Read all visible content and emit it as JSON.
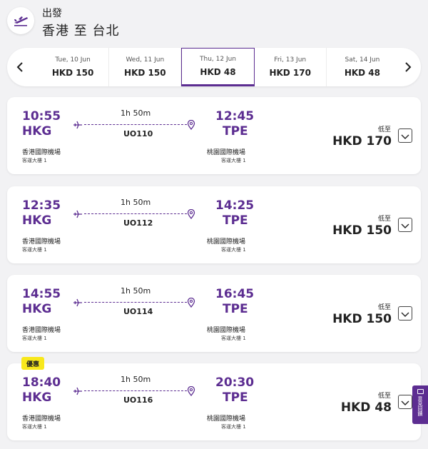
{
  "header": {
    "direction": "出發",
    "route": "香港 至 台北",
    "icon": "departure-plane-icon"
  },
  "date_strip": {
    "prev_icon": "chevron-left-icon",
    "next_icon": "chevron-right-icon",
    "dates": [
      {
        "date": "Tue, 10 Jun",
        "price": "HKD 150",
        "selected": false
      },
      {
        "date": "Wed, 11 Jun",
        "price": "HKD 150",
        "selected": false
      },
      {
        "date": "Thu, 12 Jun",
        "price": "HKD 48",
        "selected": true
      },
      {
        "date": "Fri, 13 Jun",
        "price": "HKD 170",
        "selected": false
      },
      {
        "date": "Sat, 14 Jun",
        "price": "HKD 48",
        "selected": false
      }
    ]
  },
  "flights": [
    {
      "dep_time": "10:55",
      "dep_code": "HKG",
      "dep_airport": "香港國際機場",
      "dep_terminal": "客運大樓 1",
      "arr_time": "12:45",
      "arr_code": "TPE",
      "arr_airport": "桃園國際機場",
      "arr_terminal": "客運大樓 1",
      "duration": "1h 50m",
      "flight_no": "UO110",
      "from_label": "低至",
      "price": "HKD 170",
      "badge": ""
    },
    {
      "dep_time": "12:35",
      "dep_code": "HKG",
      "dep_airport": "香港國際機場",
      "dep_terminal": "客運大樓 1",
      "arr_time": "14:25",
      "arr_code": "TPE",
      "arr_airport": "桃園國際機場",
      "arr_terminal": "客運大樓 1",
      "duration": "1h 50m",
      "flight_no": "UO112",
      "from_label": "低至",
      "price": "HKD 150",
      "badge": ""
    },
    {
      "dep_time": "14:55",
      "dep_code": "HKG",
      "dep_airport": "香港國際機場",
      "dep_terminal": "客運大樓 1",
      "arr_time": "16:45",
      "arr_code": "TPE",
      "arr_airport": "桃園國際機場",
      "arr_terminal": "客運大樓 1",
      "duration": "1h 50m",
      "flight_no": "UO114",
      "from_label": "低至",
      "price": "HKD 150",
      "badge": ""
    },
    {
      "dep_time": "18:40",
      "dep_code": "HKG",
      "dep_airport": "香港國際機場",
      "dep_terminal": "客運大樓 1",
      "arr_time": "20:30",
      "arr_code": "TPE",
      "arr_airport": "桃園國際機場",
      "arr_terminal": "客運大樓 1",
      "duration": "1h 50m",
      "flight_no": "UO116",
      "from_label": "低至",
      "price": "HKD 48",
      "badge": "優惠"
    }
  ],
  "side_tab": {
    "label": "意見回饋",
    "icon": "feedback-icon"
  },
  "colors": {
    "brand": "#5c2d91",
    "badge": "#f8e81c",
    "background": "#f2f2f4"
  }
}
